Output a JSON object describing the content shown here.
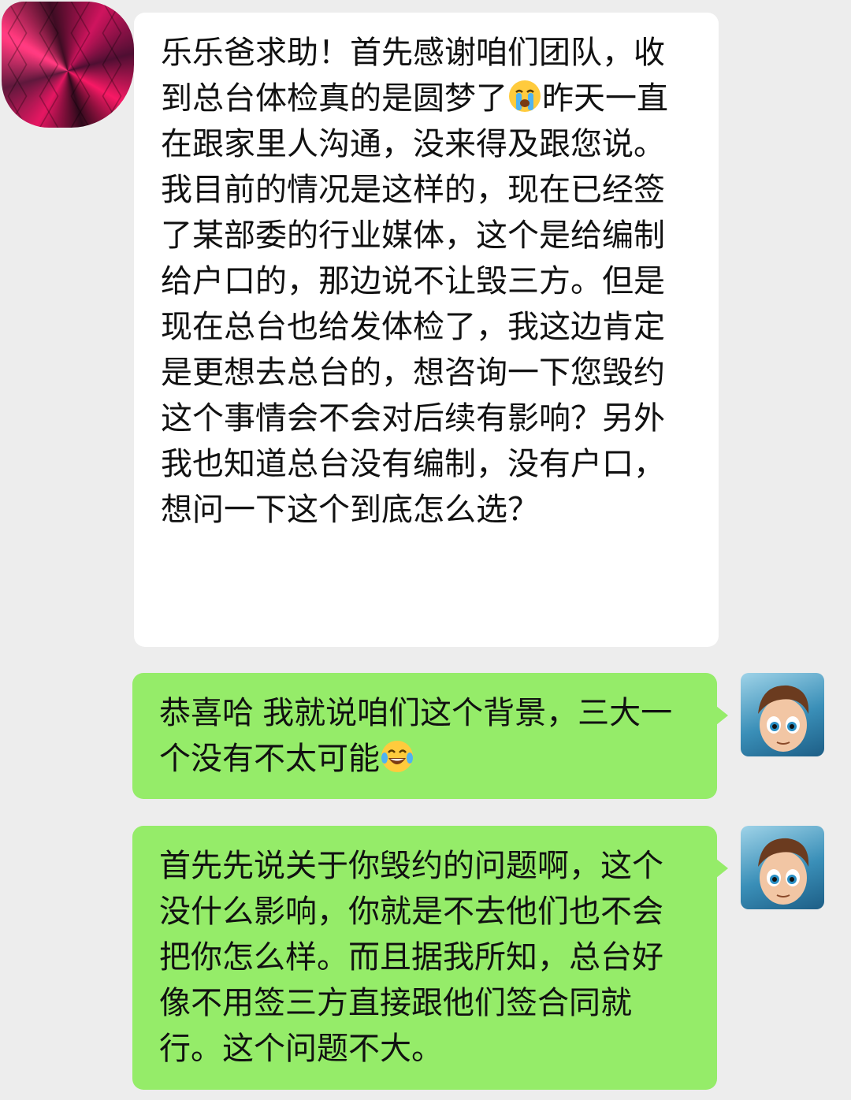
{
  "messages": [
    {
      "side": "incoming",
      "avatar_icon": "pink-polygon-avatar-icon",
      "paragraphs": [
        {
          "before": "乐乐爸求助！首先感谢咱们团队，收到总台体检真的是圆梦了",
          "emoji": "loudly-crying-face-emoji",
          "after": "昨天一直在跟家里人沟通，没来得及跟您说。"
        },
        {
          "text": "我目前的情况是这样的，现在已经签了某部委的行业媒体，这个是给编制给户口的，那边说不让毁三方。但是现在总台也给发体检了，我这边肯定是更想去总台的，想咨询一下您毁约这个事情会不会对后续有影响？另外我也知道总台没有编制，没有户口，想问一下这个到底怎么选？"
        }
      ]
    },
    {
      "side": "outgoing",
      "avatar_icon": "cartoon-boy-avatar-icon",
      "text": "恭喜哈 我就说咱们这个背景，三大一个没有不太可能",
      "emoji": "tears-of-joy-emoji"
    },
    {
      "side": "outgoing",
      "avatar_icon": "cartoon-boy-avatar-icon",
      "text": "首先先说关于你毁约的问题啊，这个没什么影响，你就是不去他们也不会把你怎么样。而且据我所知，总台好像不用签三方直接跟他们签合同就行。这个问题不大。"
    }
  ],
  "colors": {
    "background": "#ededed",
    "incoming_bubble": "#ffffff",
    "outgoing_bubble": "#95ec69",
    "text": "#111111"
  }
}
